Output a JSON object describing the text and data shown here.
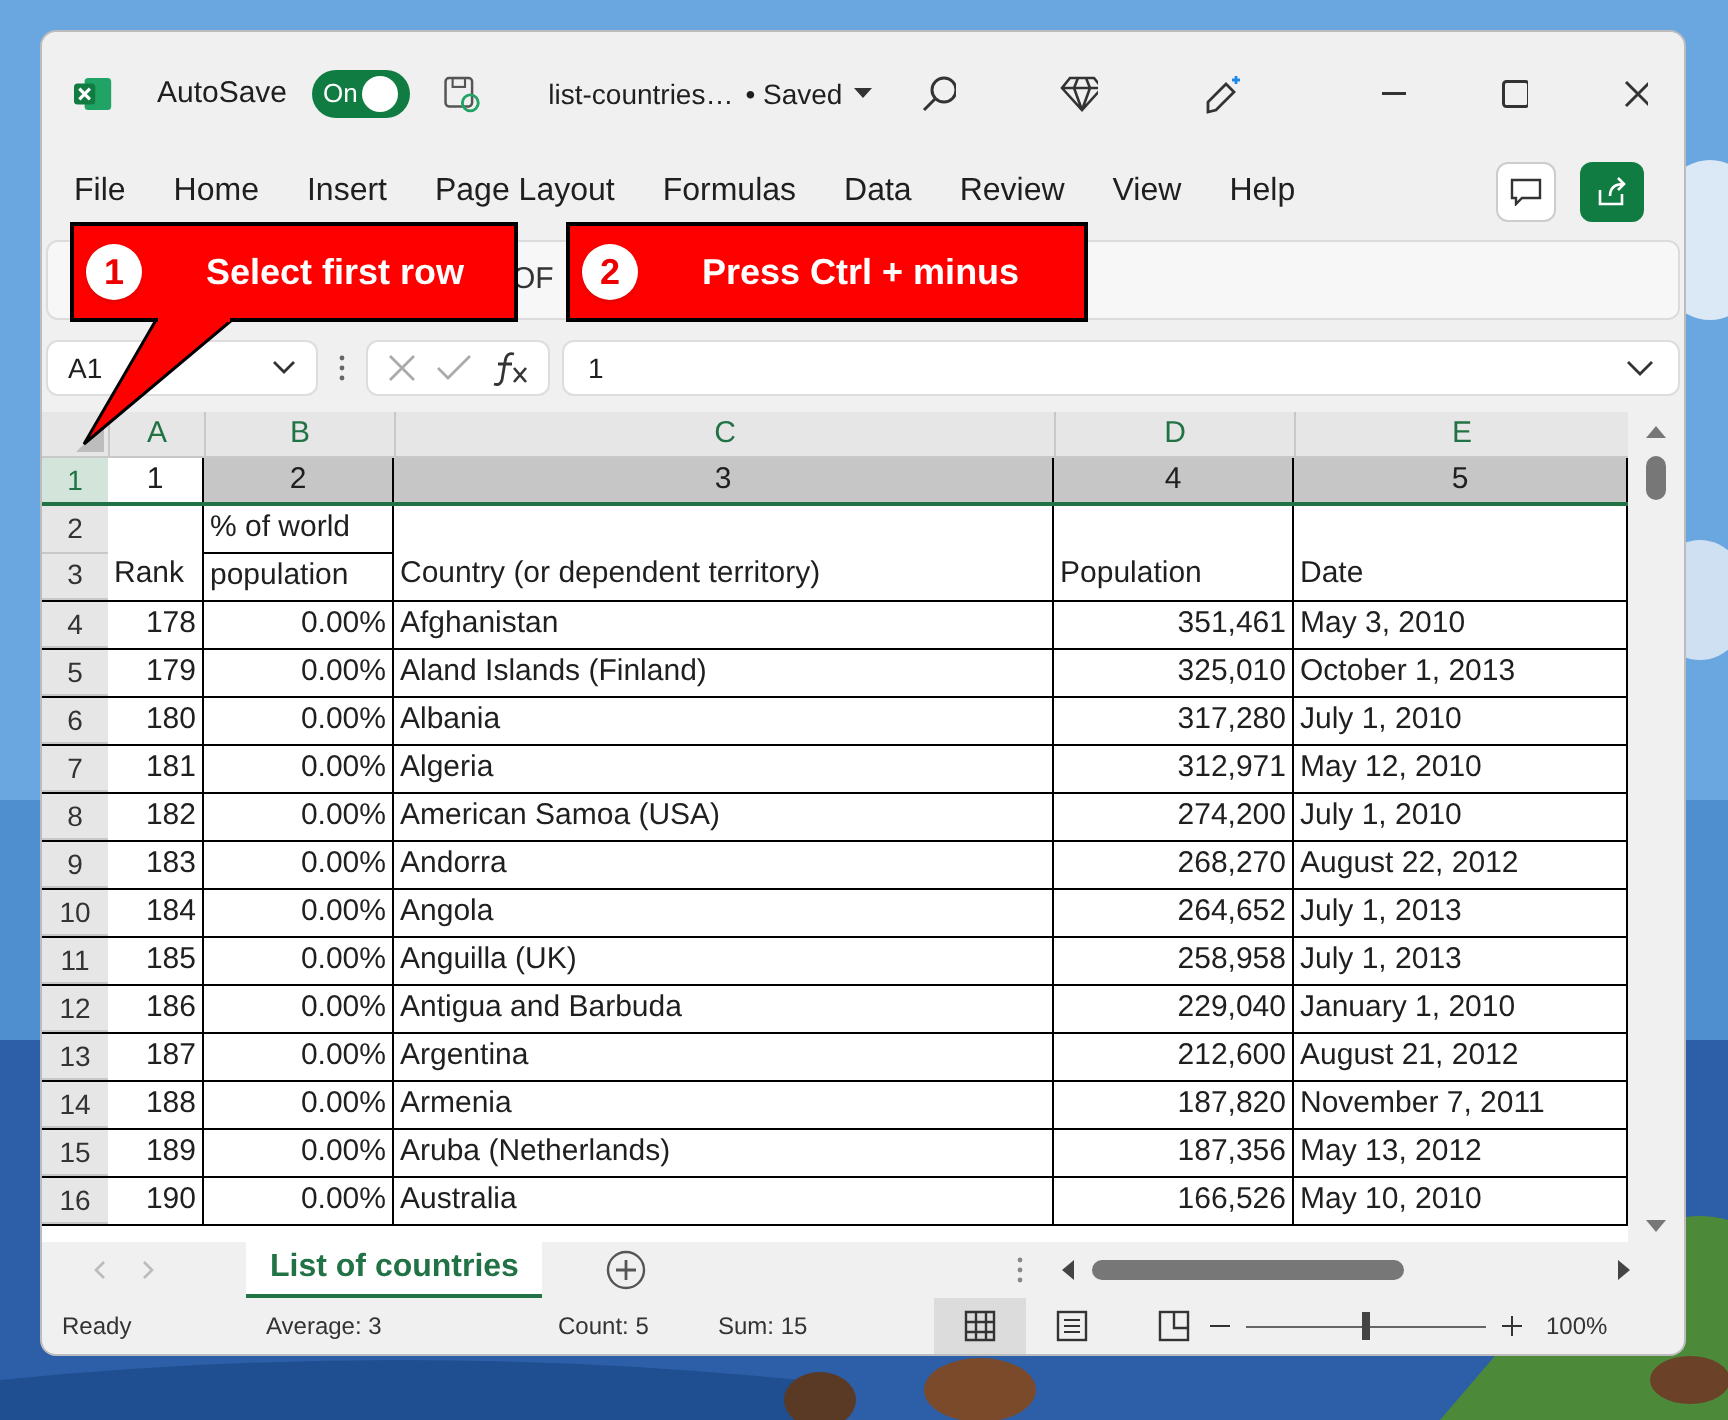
{
  "title_bar": {
    "autosave_label": "AutoSave",
    "autosave_toggle": {
      "label": "On",
      "on": true
    },
    "file_name": "list-countries…",
    "save_status": "• Saved"
  },
  "menu": [
    "File",
    "Home",
    "Insert",
    "Page Layout",
    "Formulas",
    "Data",
    "Review",
    "View",
    "Help"
  ],
  "ribbon_text": "OF",
  "callouts": [
    {
      "number": "1",
      "text": "Select first row"
    },
    {
      "number": "2",
      "text": "Press Ctrl + minus"
    }
  ],
  "name_box": "A1",
  "formula": "1",
  "columns": [
    "A",
    "B",
    "C",
    "D",
    "E"
  ],
  "selected_row": {
    "row": "1",
    "selected": true,
    "cells": [
      "1",
      "2",
      "3",
      "4",
      "5"
    ]
  },
  "header_rows": {
    "row_numbers": [
      "2",
      "3"
    ],
    "rank": "Rank",
    "share_lines": [
      "% of world",
      "population"
    ],
    "country": "Country (or dependent territory)",
    "population": "Population",
    "date": "Date"
  },
  "rows": [
    {
      "row": "4",
      "cells": [
        "178",
        "0.00%",
        "Afghanistan",
        "351,461",
        "May 3, 2010"
      ]
    },
    {
      "row": "5",
      "cells": [
        "179",
        "0.00%",
        "Aland Islands (Finland)",
        "325,010",
        "October 1, 2013"
      ]
    },
    {
      "row": "6",
      "cells": [
        "180",
        "0.00%",
        "Albania",
        "317,280",
        "July 1, 2010"
      ]
    },
    {
      "row": "7",
      "cells": [
        "181",
        "0.00%",
        "Algeria",
        "312,971",
        "May 12, 2010"
      ]
    },
    {
      "row": "8",
      "cells": [
        "182",
        "0.00%",
        "American Samoa (USA)",
        "274,200",
        "July 1, 2010"
      ]
    },
    {
      "row": "9",
      "cells": [
        "183",
        "0.00%",
        "Andorra",
        "268,270",
        "August 22, 2012"
      ]
    },
    {
      "row": "10",
      "cells": [
        "184",
        "0.00%",
        "Angola",
        "264,652",
        "July 1, 2013"
      ]
    },
    {
      "row": "11",
      "cells": [
        "185",
        "0.00%",
        "Anguilla (UK)",
        "258,958",
        "July 1, 2013"
      ]
    },
    {
      "row": "12",
      "cells": [
        "186",
        "0.00%",
        "Antigua and Barbuda",
        "229,040",
        "January 1, 2010"
      ]
    },
    {
      "row": "13",
      "cells": [
        "187",
        "0.00%",
        "Argentina",
        "212,600",
        "August 21, 2012"
      ]
    },
    {
      "row": "14",
      "cells": [
        "188",
        "0.00%",
        "Armenia",
        "187,820",
        "November 7, 2011"
      ]
    },
    {
      "row": "15",
      "cells": [
        "189",
        "0.00%",
        "Aruba (Netherlands)",
        "187,356",
        "May 13, 2012"
      ]
    },
    {
      "row": "16",
      "cells": [
        "190",
        "0.00%",
        "Australia",
        "166,526",
        "May 10, 2010"
      ]
    }
  ],
  "sheet_tabs": [
    {
      "label": "List of countries",
      "selected": true
    }
  ],
  "status_bar": {
    "ready": "Ready",
    "average": "Average: 3",
    "count": "Count: 5",
    "sum": "Sum: 15",
    "views": [
      {
        "kind": "normal",
        "selected": true
      },
      {
        "kind": "page_layout",
        "selected": false
      }
    ],
    "zoom_slider": {
      "level": 0.5
    },
    "zoom": "100%"
  }
}
